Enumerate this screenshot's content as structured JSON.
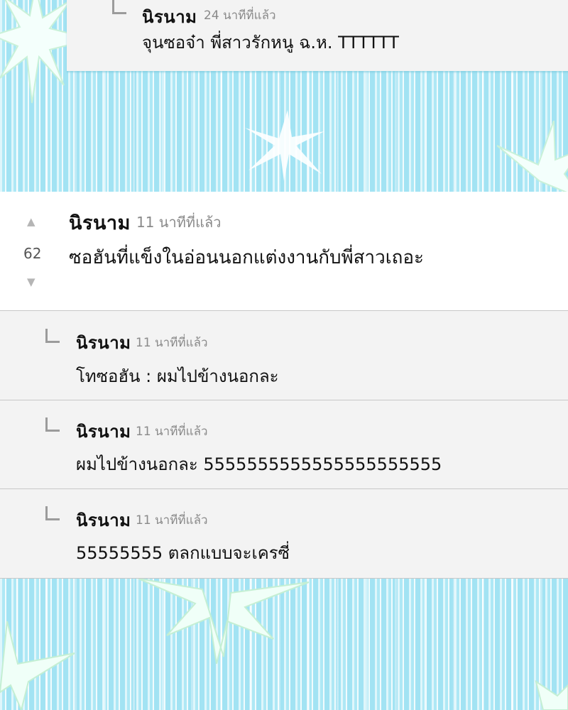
{
  "top_reply": {
    "name": "นิรนาม",
    "time": "24 นาทีที่แล้ว",
    "text": "จุนซอจ๋า พี่สาวรักหนู ฉ.ห. TTTTTT"
  },
  "main_comment": {
    "name": "นิรนาม",
    "time": "11 นาทีที่แล้ว",
    "text": "ซอฮันที่แข็งในอ่อนนอกแต่งงานกับพี่สาวเถอะ",
    "votes": "62",
    "upvote_icon": "▲",
    "downvote_icon": "▼"
  },
  "replies": [
    {
      "name": "นิรนาม",
      "time": "11 นาทีที่แล้ว",
      "text": "โทซอฮัน : ผมไปข้างนอกละ"
    },
    {
      "name": "นิรนาม",
      "time": "11 นาทีที่แล้ว",
      "text": "ผมไปข้างนอกละ 5555555555555555555555"
    },
    {
      "name": "นิรนาม",
      "time": "11 นาทีที่แล้ว",
      "text": "55555555 ตลกแบบจะเครซี่"
    }
  ]
}
